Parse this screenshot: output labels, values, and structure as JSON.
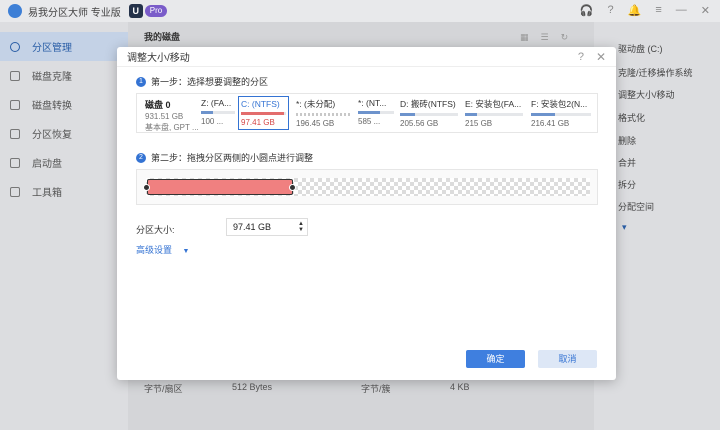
{
  "app": {
    "title": "易我分区大师 专业版",
    "edition_badge": "U",
    "edition_label": "Pro"
  },
  "titlebar_icons": [
    "headset-icon",
    "help-icon",
    "bell-icon",
    "menu-icon",
    "minimize-icon",
    "close-icon"
  ],
  "sidebar": {
    "items": [
      {
        "label": "分区管理",
        "icon": "partition-icon",
        "active": true
      },
      {
        "label": "磁盘克隆",
        "icon": "clone-icon"
      },
      {
        "label": "磁盘转换",
        "icon": "convert-icon"
      },
      {
        "label": "分区恢复",
        "icon": "recover-icon"
      },
      {
        "label": "启动盘",
        "icon": "bootdisk-icon"
      },
      {
        "label": "工具箱",
        "icon": "toolbox-icon"
      }
    ]
  },
  "main": {
    "heading": "我的磁盘"
  },
  "right_panel": {
    "items": [
      "驱动盘 (C:)",
      "克隆/迁移操作系统",
      "调整大小/移动",
      "格式化",
      "删除",
      "合并",
      "拆分",
      "分配空间"
    ],
    "more": "▾"
  },
  "bottom_info": [
    {
      "label": "字节/扇区",
      "value": "512 Bytes"
    },
    {
      "label": "字节/簇",
      "value": "4 KB"
    }
  ],
  "dialog": {
    "title": "调整大小/移动",
    "help": "?",
    "close": "✕",
    "step1": {
      "num": "1",
      "label": "第一步：选择想要调整的分区"
    },
    "step2": {
      "num": "2",
      "label": "第二步：拖拽分区两侧的小圆点进行调整"
    },
    "disk": {
      "name": "磁盘 0",
      "size": "931.51 GB",
      "type": "基本盘, GPT ..."
    },
    "partitions": [
      {
        "name": "Z: (FA...",
        "size": "100 ...",
        "fill": 0.35
      },
      {
        "name": "C: (NTFS)",
        "size": "97.41 GB",
        "fill": 0.95,
        "selected": true
      },
      {
        "name": "*: (未分配)",
        "size": "196.45 GB",
        "fill": 0,
        "unallocated": true
      },
      {
        "name": "*: (NT...",
        "size": "585 ...",
        "fill": 0.6
      },
      {
        "name": "D: 搬砖(NTFS)",
        "size": "205.56 GB",
        "fill": 0.25
      },
      {
        "name": "E: 安装包(FA...",
        "size": "215 GB",
        "fill": 0.2
      },
      {
        "name": "F: 安装包2(N...",
        "size": "216.41 GB",
        "fill": 0.4
      }
    ],
    "slider": {
      "used_fraction": 0.33
    },
    "size_label": "分区大小:",
    "size_value": "97.41 GB",
    "advanced": "高级设置",
    "ok": "确定",
    "cancel": "取消"
  }
}
